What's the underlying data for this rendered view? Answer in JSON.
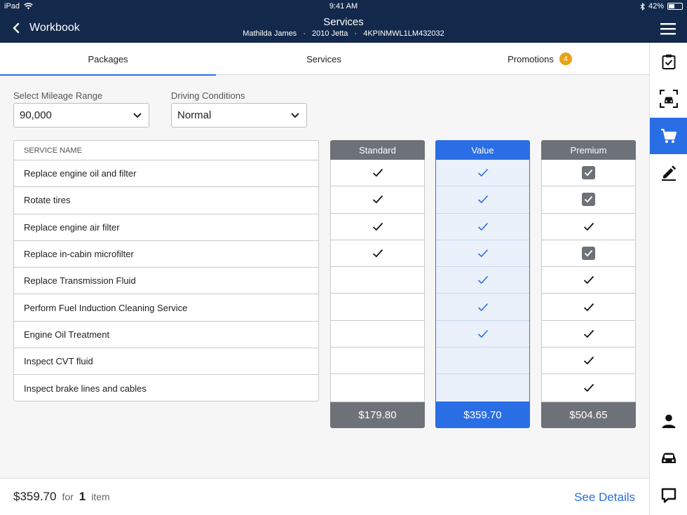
{
  "status_bar": {
    "device": "iPad",
    "time": "9:41 AM",
    "battery": "42%"
  },
  "header": {
    "back_label": "Workbook",
    "title": "Services",
    "customer": "Mathilda James",
    "vehicle": "2010 Jetta",
    "vin": "4KPINMWL1LM432032",
    "separator": "·"
  },
  "tabs": [
    {
      "label": "Packages",
      "active": true
    },
    {
      "label": "Services",
      "active": false
    },
    {
      "label": "Promotions",
      "active": false,
      "badge": "4"
    }
  ],
  "filters": {
    "mileage": {
      "label": "Select Mileage Range",
      "value": "90,000"
    },
    "conditions": {
      "label": "Driving Conditions",
      "value": "Normal"
    }
  },
  "services_table": {
    "header": "SERVICE NAME",
    "rows": [
      "Replace engine oil and filter",
      "Rotate tires",
      "Replace engine air filter",
      "Replace in-cabin microfilter",
      "Replace Transmission Fluid",
      "Perform Fuel Induction Cleaning Service",
      "Engine Oil Treatment",
      "Inspect CVT fluid",
      "Inspect brake lines and cables"
    ]
  },
  "packages": [
    {
      "name": "Standard",
      "price": "$179.80",
      "style": "gray",
      "marks": [
        "check",
        "check",
        "check",
        "check",
        "none",
        "none",
        "none",
        "none",
        "none"
      ]
    },
    {
      "name": "Value",
      "price": "$359.70",
      "style": "blue",
      "marks": [
        "check",
        "check",
        "check",
        "check",
        "check",
        "check",
        "check",
        "none",
        "none"
      ]
    },
    {
      "name": "Premium",
      "price": "$504.65",
      "style": "gray",
      "marks": [
        "box",
        "box",
        "check",
        "box",
        "check",
        "check",
        "check",
        "check",
        "check"
      ]
    }
  ],
  "colors": {
    "header_bg": "#13294b",
    "accent": "#2a6ee6",
    "package_gray": "#6d7278",
    "badge": "#e8a317"
  },
  "rail_icons": [
    "clipboard-check-icon",
    "vehicle-scan-icon",
    "cart-icon",
    "edit-icon",
    "person-icon",
    "car-icon",
    "chat-icon"
  ],
  "footer": {
    "total": "$359.70",
    "for_label": "for",
    "count": "1",
    "item_label": "item",
    "details_label": "See Details"
  }
}
